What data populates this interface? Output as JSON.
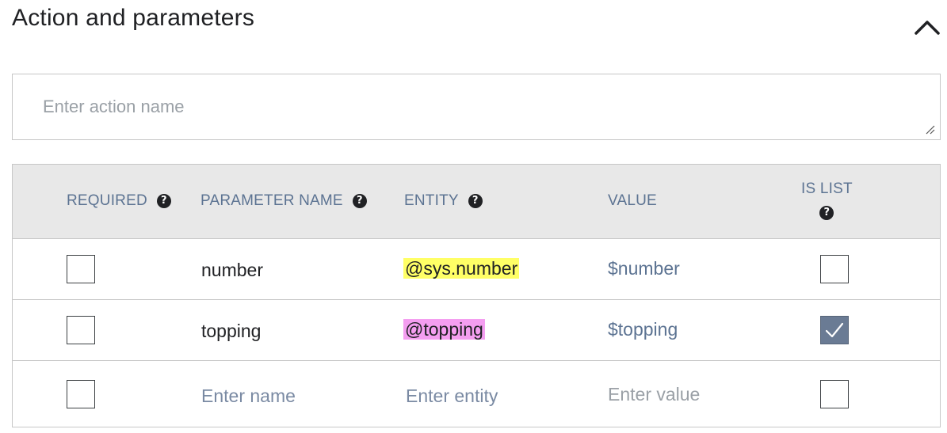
{
  "section": {
    "title": "Action and parameters"
  },
  "action": {
    "placeholder": "Enter action name",
    "value": ""
  },
  "table": {
    "headers": {
      "required": "REQUIRED",
      "parameter_name": "PARAMETER NAME",
      "entity": "ENTITY",
      "value": "VALUE",
      "is_list": "IS LIST"
    },
    "help_glyph": "?",
    "rows": [
      {
        "required": false,
        "parameter_name": "number",
        "entity": "@sys.number",
        "entity_highlight": "#ffff66",
        "value": "$number",
        "is_list": false
      },
      {
        "required": false,
        "parameter_name": "topping",
        "entity": "@topping",
        "entity_highlight": "#f49ef0",
        "value": "$topping",
        "is_list": true
      }
    ],
    "new_row": {
      "name_placeholder": "Enter name",
      "entity_placeholder": "Enter entity",
      "value_placeholder": "Enter value",
      "required": false,
      "is_list": false
    }
  },
  "icons": {
    "collapse": "chevron-up-icon",
    "help": "question-circle-icon",
    "check": "checkmark-icon",
    "resize": "resize-handle-icon"
  },
  "colors": {
    "header_text": "#5c7392",
    "header_bg": "#e8e8e8",
    "checkbox_checked": "#6a7b94"
  }
}
